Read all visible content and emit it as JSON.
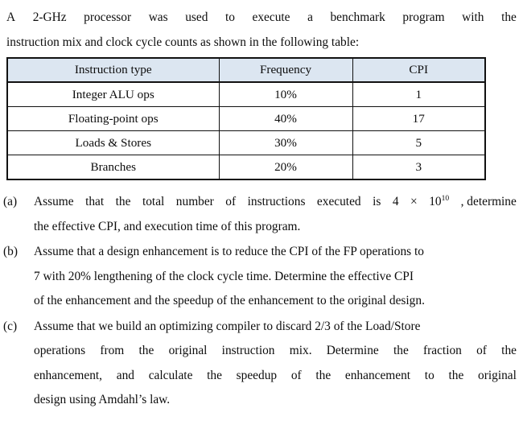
{
  "document": {
    "intro": {
      "full_text": "A 2-GHz processor was used to execute a benchmark program with the instruction mix and clock cycle counts as shown in the following table:",
      "line1_words": [
        "A",
        "2-GHz",
        "processor",
        "was",
        "used",
        "to",
        "execute",
        "a",
        "benchmark",
        "program",
        "with",
        "the"
      ],
      "line2": "instruction mix and clock cycle counts as shown in the following table:"
    },
    "table": {
      "headers": [
        "Instruction type",
        "Frequency",
        "CPI"
      ],
      "rows": [
        {
          "type": "Integer ALU ops",
          "frequency": "10%",
          "cpi": "1"
        },
        {
          "type": "Floating-point ops",
          "frequency": "40%",
          "cpi": "17"
        },
        {
          "type": "Loads & Stores",
          "frequency": "30%",
          "cpi": "5"
        },
        {
          "type": "Branches",
          "frequency": "20%",
          "cpi": "3"
        }
      ],
      "header_background": "#dce6f1",
      "border_color": "#111111"
    },
    "questions": [
      {
        "label": "(a)",
        "full_text": "Assume that the total number of instructions executed is 4 × 10^10, determine the effective CPI, and execution time of this program.",
        "lines": [
          {
            "justified": true,
            "words": [
              "Assume",
              "that",
              "the",
              "total",
              "number",
              "of",
              "instructions",
              "executed",
              "is",
              "4",
              "×",
              "10",
              "10",
              ", determine"
            ]
          },
          {
            "justified": false,
            "text": "the effective CPI, and execution time of this program."
          }
        ],
        "superscript_line_index": 0,
        "base": "10",
        "exponent": "10"
      },
      {
        "label": "(b)",
        "full_text": "Assume that a design enhancement is to reduce the CPI of the FP operations to 7 with 20% lengthening of the clock cycle time. Determine the effective CPI of the enhancement and the speedup of the enhancement to the original design.",
        "lines": [
          {
            "justified": false,
            "text": "Assume that a design enhancement is to reduce the CPI of the FP operations to"
          },
          {
            "justified": false,
            "text": "7 with 20% lengthening of the clock cycle time. Determine the effective CPI"
          },
          {
            "justified": false,
            "text": "of the enhancement and the speedup of the enhancement to the original design."
          }
        ]
      },
      {
        "label": "(c)",
        "full_text": "Assume that we build an optimizing compiler to discard 2/3 of the Load/Store operations from the original instruction mix. Determine the fraction of the enhancement, and calculate the speedup of the enhancement to the original design using Amdahl's law.",
        "lines": [
          {
            "justified": false,
            "text": "Assume that we build an optimizing compiler to discard 2/3 of the Load/Store"
          },
          {
            "justified": true,
            "words": [
              "operations",
              "from",
              "the",
              "original",
              "instruction",
              "mix.",
              "Determine",
              "the",
              "fraction",
              "of",
              "the"
            ]
          },
          {
            "justified": true,
            "words": [
              "enhancement,",
              "and",
              "calculate",
              "the",
              "speedup",
              "of",
              "the",
              "enhancement",
              "to",
              "the",
              "original"
            ]
          },
          {
            "justified": false,
            "text": "design using Amdahl’s law."
          }
        ]
      }
    ]
  }
}
